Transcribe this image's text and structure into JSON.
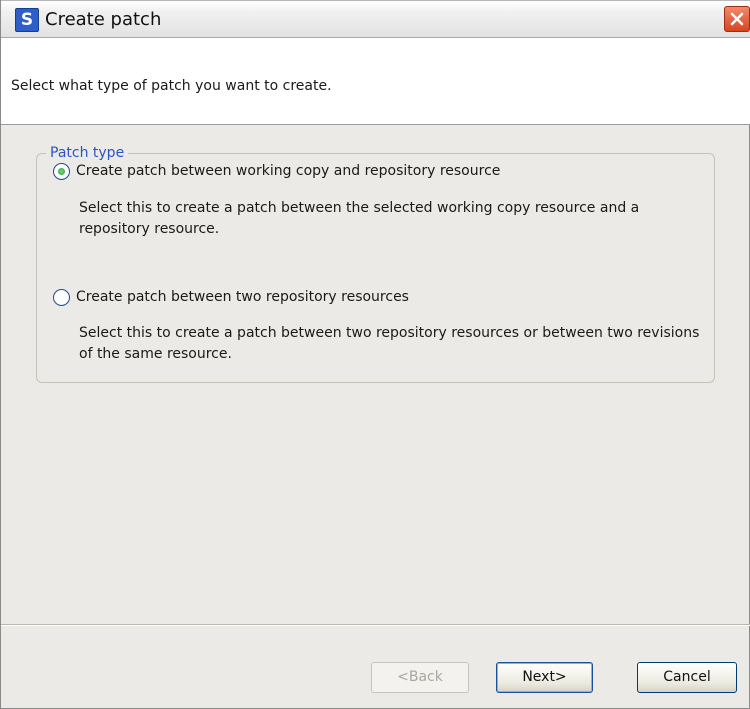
{
  "window": {
    "title": "Create patch",
    "app_icon_letter": "S"
  },
  "header": {
    "description": "Select what type of patch you want to create."
  },
  "patch_type": {
    "legend": "Patch type",
    "options": [
      {
        "label": "Create patch between working copy and repository resource",
        "description": "Select this to create a patch between the selected working copy resource and a repository resource.",
        "selected": true
      },
      {
        "label": "Create patch between two repository resources",
        "description": "Select this to create a patch between two repository resources or between two revisions of the same resource.",
        "selected": false
      }
    ]
  },
  "buttons": {
    "back": "<Back",
    "next": "Next>",
    "cancel": "Cancel"
  },
  "colors": {
    "legend_text": "#2a54c0",
    "close_button": "#d8451f",
    "radio_selected": "#1f9e2d"
  }
}
